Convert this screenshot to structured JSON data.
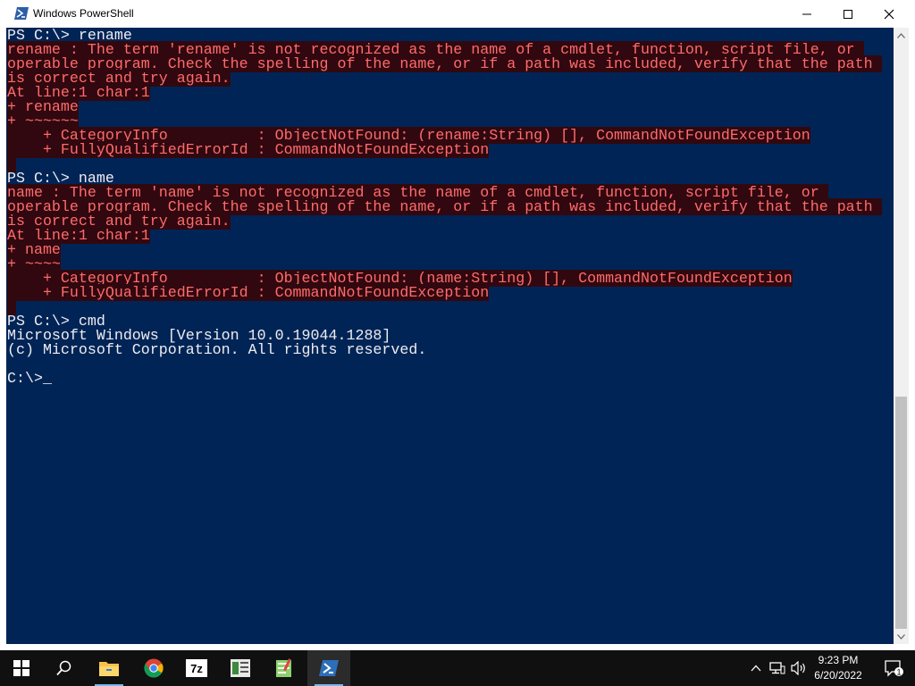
{
  "window": {
    "title": "Windows PowerShell",
    "icon": "powershell-icon"
  },
  "console": {
    "lines": [
      {
        "text": "PS C:\\> rename",
        "type": "normal"
      },
      {
        "text": "rename : The term 'rename' is not recognized as the name of a cmdlet, function, script file, or ",
        "type": "error"
      },
      {
        "text": "operable program. Check the spelling of the name, or if a path was included, verify that the path ",
        "type": "error"
      },
      {
        "text": "is correct and try again.",
        "type": "error"
      },
      {
        "text": "At line:1 char:1",
        "type": "error"
      },
      {
        "text": "+ rename",
        "type": "error"
      },
      {
        "text": "+ ~~~~~~",
        "type": "error"
      },
      {
        "text": "    + CategoryInfo          : ObjectNotFound: (rename:String) [], CommandNotFoundException",
        "type": "error"
      },
      {
        "text": "    + FullyQualifiedErrorId : CommandNotFoundException",
        "type": "error"
      },
      {
        "text": " ",
        "type": "error"
      },
      {
        "text": "PS C:\\> name",
        "type": "normal"
      },
      {
        "text": "name : The term 'name' is not recognized as the name of a cmdlet, function, script file, or ",
        "type": "error"
      },
      {
        "text": "operable program. Check the spelling of the name, or if a path was included, verify that the path ",
        "type": "error"
      },
      {
        "text": "is correct and try again.",
        "type": "error"
      },
      {
        "text": "At line:1 char:1",
        "type": "error"
      },
      {
        "text": "+ name",
        "type": "error"
      },
      {
        "text": "+ ~~~~",
        "type": "error"
      },
      {
        "text": "    + CategoryInfo          : ObjectNotFound: (name:String) [], CommandNotFoundException",
        "type": "error"
      },
      {
        "text": "    + FullyQualifiedErrorId : CommandNotFoundException",
        "type": "error"
      },
      {
        "text": " ",
        "type": "error"
      },
      {
        "text": "PS C:\\> cmd",
        "type": "normal"
      },
      {
        "text": "Microsoft Windows [Version 10.0.19044.1288]",
        "type": "normal"
      },
      {
        "text": "(c) Microsoft Corporation. All rights reserved.",
        "type": "normal"
      },
      {
        "text": "",
        "type": "normal"
      },
      {
        "text": "C:\\>",
        "type": "prompt"
      }
    ],
    "cursor": "_",
    "colors": {
      "background": "#012456",
      "text": "#eeedf0",
      "error": "#ff6b6b",
      "error_bg": "#31080f"
    }
  },
  "taskbar": {
    "items": [
      "start-icon",
      "search-icon",
      "file-explorer-icon",
      "chrome-icon",
      "7zip-icon",
      "app-icon",
      "notepad-icon",
      "powershell-icon"
    ],
    "clock": {
      "time": "9:23 PM",
      "date": "6/20/2022"
    },
    "notifications_count": "1"
  }
}
